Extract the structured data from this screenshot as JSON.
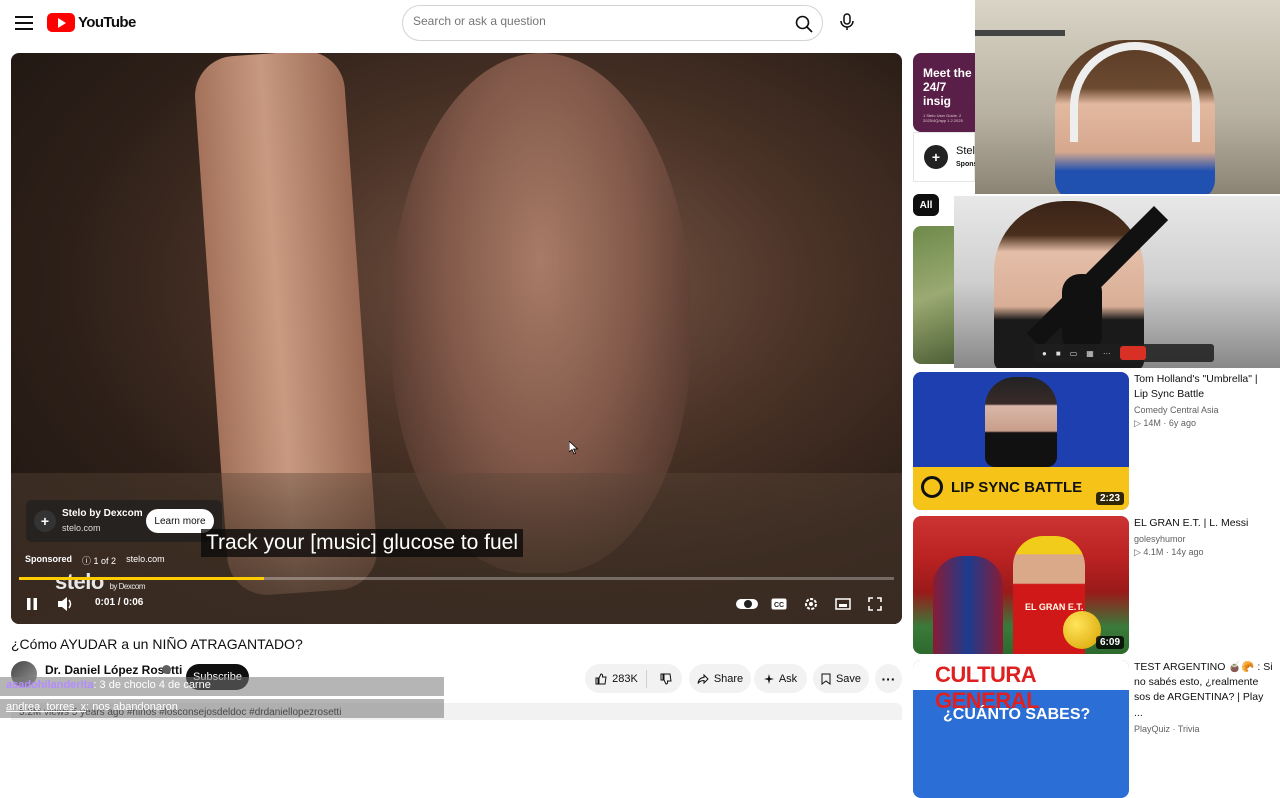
{
  "header": {
    "logo_text": "YouTube",
    "search_placeholder": "Search or ask a question"
  },
  "player": {
    "ad": {
      "advertiser": "Stelo by Dexcom",
      "domain": "stelo.com",
      "cta": "Learn more",
      "sponsored_label": "Sponsored",
      "ad_count": "1 of 2",
      "sponsored_domain": "stelo.com",
      "brand_watermark": "stelo",
      "brand_watermark_sub": "by Dexcom"
    },
    "caption": "Track your [music] glucose to fuel",
    "time": "0:01 / 0:06",
    "progress": 0.28,
    "progress_color": "#ffcc00"
  },
  "video": {
    "title": "¿Cómo AYUDAR a un NIÑO ATRAGANTADO?",
    "channel": "Dr. Daniel López Rosetti",
    "subscribe_label": "Subscribe",
    "likes": "283K",
    "share_label": "Share",
    "ask_label": "Ask",
    "save_label": "Save",
    "meta": "5.2M views  5 years ago  #niños #losconsejosdeldoc #drdaniellopezrosetti"
  },
  "chat": [
    {
      "user": "asadohilanderita",
      "message": ": 3 de choclo 4 de carne"
    },
    {
      "user": "andrea_torres_x",
      "message": ": nos abandonaron"
    }
  ],
  "sidebar": {
    "ad_headline": "Meet the 24/7 insig",
    "ad_fineprint": "1 Stelo User Guide. 2 2025/4Q/app 1.2.2025",
    "ad_brand": "Stel",
    "ad_sponsored": "Spons",
    "chip_all": "All",
    "recommendations": [
      {
        "title": "Tom Holland's \"Umbrella\" | Lip Sync Battle",
        "channel": "Comedy Central Asia",
        "meta": "14M · 6y ago",
        "duration": "2:23",
        "thumb_text": "LIP SYNC BATTLE"
      },
      {
        "title": "EL GRAN E.T. | L. Messi",
        "channel": "golesyhumor",
        "meta": "4.1M · 14y ago",
        "duration": "6:09",
        "thumb_text": "EL GRAN E.T."
      },
      {
        "title": "TEST ARGENTINO 🧉🥐 : Si no sabés esto, ¿realmente sos de ARGENTINA? | Play ...",
        "channel": "PlayQuiz · Trivia",
        "meta": "",
        "duration": "",
        "thumb_text": "CULTURA GENERAL",
        "thumb_sub": "¿CUÁNTO SABES?"
      }
    ]
  }
}
